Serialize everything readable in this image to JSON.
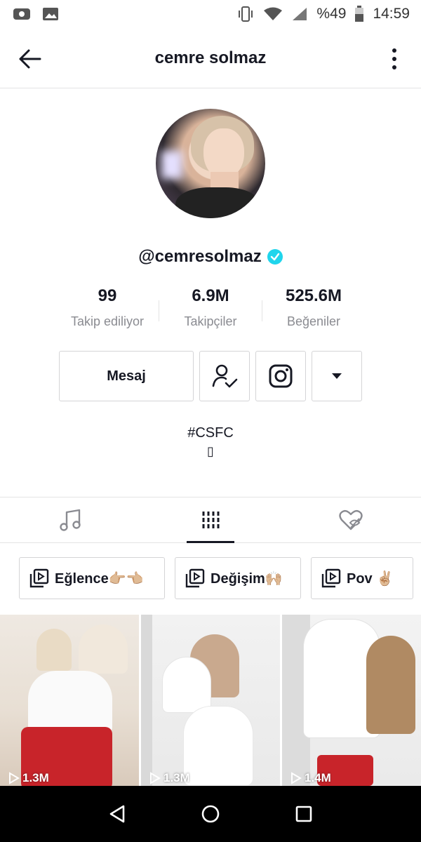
{
  "status_bar": {
    "battery": "%49",
    "time": "14:59"
  },
  "header": {
    "title": "cemre solmaz"
  },
  "profile": {
    "username": "@cemresolmaz",
    "verified": true
  },
  "stats": [
    {
      "value": "99",
      "label": "Takip ediliyor"
    },
    {
      "value": "6.9M",
      "label": "Takipçiler"
    },
    {
      "value": "525.6M",
      "label": "Beğeniler"
    }
  ],
  "actions": {
    "message_label": "Mesaj"
  },
  "bio": {
    "line1": "#CSFC",
    "line2": "▯"
  },
  "playlists": [
    {
      "label": "Eğlence👉🏼👈🏼"
    },
    {
      "label": "Değişim🙌🏼"
    },
    {
      "label": "Pov ✌🏼"
    }
  ],
  "videos": [
    {
      "views": "1.3M"
    },
    {
      "views": "1.3M"
    },
    {
      "views": "1.4M"
    }
  ],
  "colors": {
    "verified": "#20d5ec",
    "text": "#161823",
    "secondary_text": "#8a8b91",
    "border": "#e3e3e4",
    "navbar": "#000000"
  }
}
